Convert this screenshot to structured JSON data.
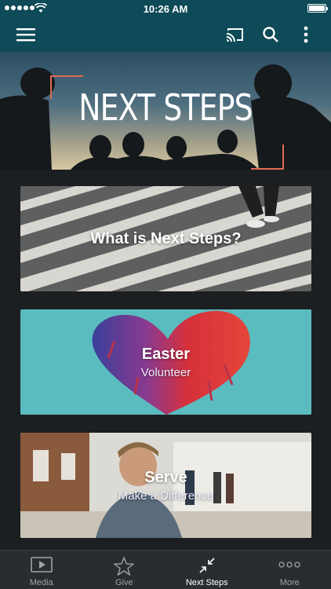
{
  "status_bar": {
    "time": "10:26 AM"
  },
  "app_bar": {
    "menu_icon": "hamburger-menu-icon",
    "cast_icon": "cast-icon",
    "search_icon": "search-icon",
    "more_icon": "more-vert-icon"
  },
  "hero": {
    "title": "NEXT STEPS"
  },
  "cards": [
    {
      "title": "What is Next Steps?",
      "subtitle": ""
    },
    {
      "title": "Easter",
      "subtitle": "Volunteer"
    },
    {
      "title": "Serve",
      "subtitle": "Make a Difference"
    }
  ],
  "tabs": [
    {
      "label": "Media",
      "icon": "media-play-icon",
      "active": false
    },
    {
      "label": "Give",
      "icon": "star-icon",
      "active": false
    },
    {
      "label": "Next Steps",
      "icon": "compress-arrows-icon",
      "active": true
    },
    {
      "label": "More",
      "icon": "more-horiz-icon",
      "active": false
    }
  ],
  "colors": {
    "app_bar": "#0e4a57",
    "accent": "#e16b4f",
    "tab_bar": "#2a2d30",
    "background": "#1c1f22"
  }
}
